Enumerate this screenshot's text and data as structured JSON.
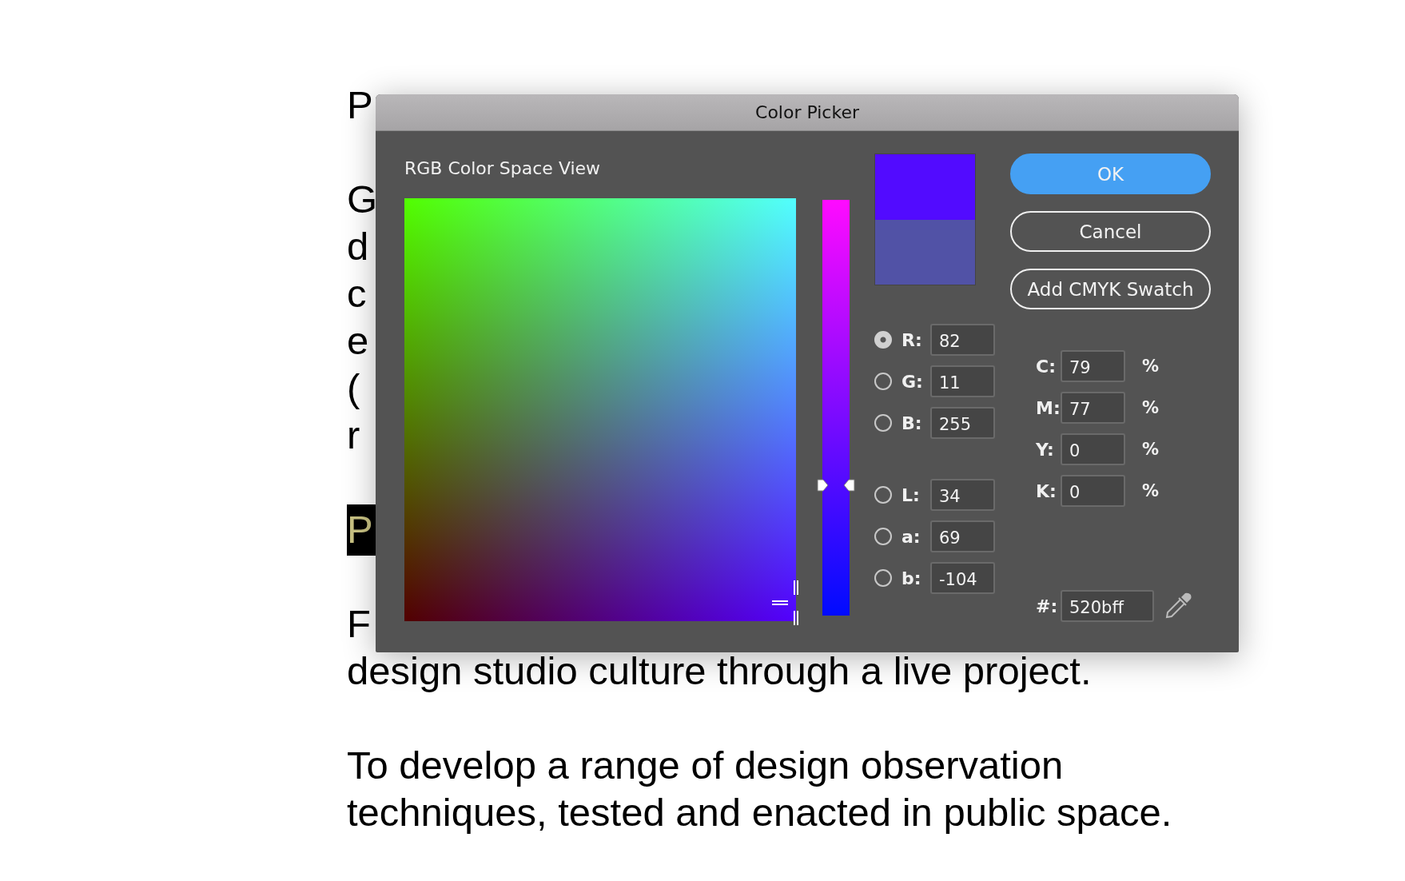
{
  "document": {
    "paragraphs": [
      {
        "kind": "heading",
        "lines": [
          "P"
        ]
      },
      {
        "kind": "body",
        "lines": [
          "G",
          "d",
          "c",
          "e",
          "(",
          "r"
        ]
      },
      {
        "kind": "highlight",
        "lines": [
          "P"
        ]
      },
      {
        "kind": "body",
        "lines": [
          "F",
          "design studio culture through a live project."
        ]
      },
      {
        "kind": "body",
        "lines": [
          "To develop a range of design observation",
          "techniques, tested and enacted in public space."
        ]
      }
    ]
  },
  "dialog": {
    "title": "Color Picker",
    "view_label": "RGB Color Space View",
    "hue_slider": {
      "level": 0.32
    },
    "swatches": [
      {
        "color": "#520bff"
      },
      {
        "color": "#5152a6"
      }
    ],
    "buttons": [
      {
        "label": "OK",
        "kind": "primary"
      },
      {
        "label": "Cancel",
        "kind": "secondary"
      },
      {
        "label": "Add CMYK Swatch",
        "kind": "secondary"
      }
    ],
    "rgb_channels": [
      {
        "label": "R:",
        "value": "82",
        "selected": true
      },
      {
        "label": "G:",
        "value": "11",
        "selected": false
      },
      {
        "label": "B:",
        "value": "255",
        "selected": false
      }
    ],
    "lab_channels": [
      {
        "label": "L:",
        "value": "34",
        "selected": false
      },
      {
        "label": "a:",
        "value": "69",
        "selected": false
      },
      {
        "label": "b:",
        "value": "-104",
        "selected": false
      }
    ],
    "cmyk": [
      {
        "label": "C:",
        "value": "79",
        "unit": "%"
      },
      {
        "label": "M:",
        "value": "77",
        "unit": "%"
      },
      {
        "label": "Y:",
        "value": "0",
        "unit": "%"
      },
      {
        "label": "K:",
        "value": "0",
        "unit": "%"
      }
    ],
    "hex": {
      "label": "#:",
      "value": "520bff"
    }
  }
}
